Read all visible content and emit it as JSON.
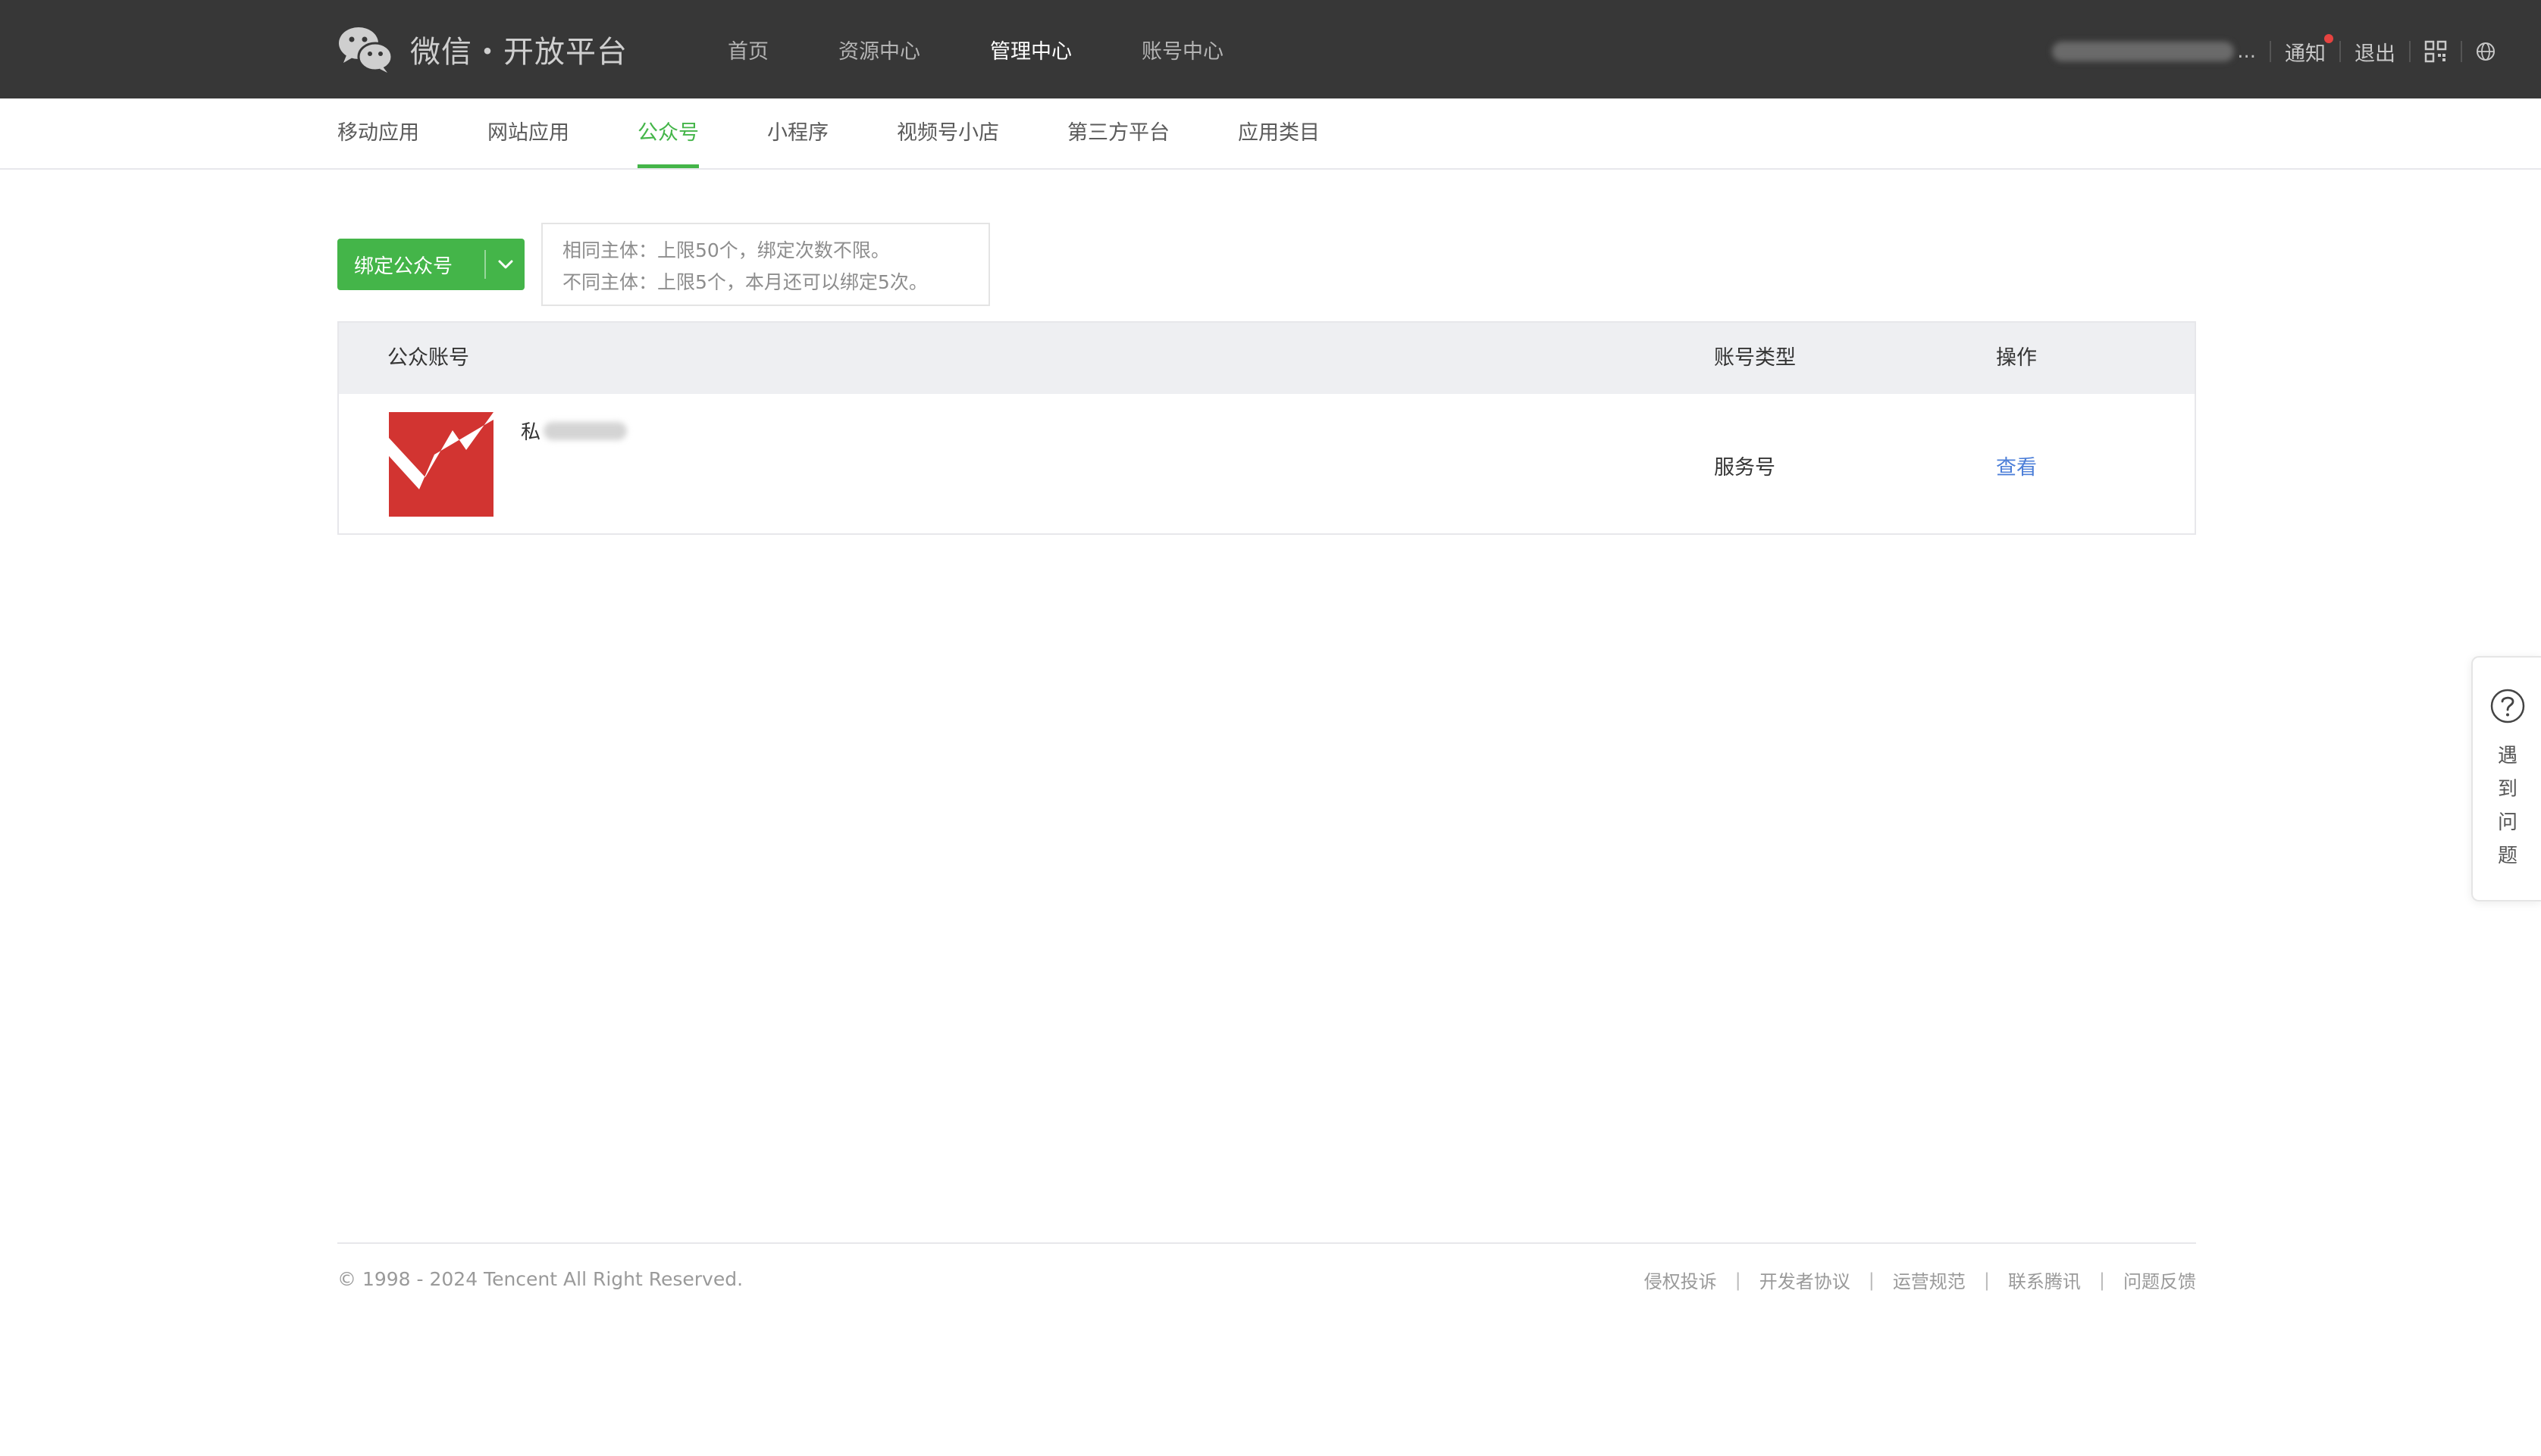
{
  "brand": {
    "name": "微信・开放平台"
  },
  "main_nav": [
    {
      "label": "首页",
      "active": false
    },
    {
      "label": "资源中心",
      "active": false
    },
    {
      "label": "管理中心",
      "active": true
    },
    {
      "label": "账号中心",
      "active": false
    }
  ],
  "user_nav": {
    "username_suffix": "...",
    "notify_label": "通知",
    "logout_label": "退出"
  },
  "sub_nav": [
    {
      "label": "移动应用",
      "active": false
    },
    {
      "label": "网站应用",
      "active": false
    },
    {
      "label": "公众号",
      "active": true
    },
    {
      "label": "小程序",
      "active": false
    },
    {
      "label": "视频号小店",
      "active": false
    },
    {
      "label": "第三方平台",
      "active": false
    },
    {
      "label": "应用类目",
      "active": false
    }
  ],
  "bind": {
    "button_label": "绑定公众号",
    "hint_line1": "相同主体：上限50个，绑定次数不限。",
    "hint_line2": "不同主体：上限5个，本月还可以绑定5次。"
  },
  "table": {
    "headers": {
      "account": "公众账号",
      "type": "账号类型",
      "action": "操作"
    },
    "rows": [
      {
        "name": "私",
        "type": "服务号",
        "action": "查看"
      }
    ]
  },
  "footer": {
    "copyright": "© 1998 - 2024 Tencent All Right Reserved.",
    "links": [
      "侵权投诉",
      "开发者协议",
      "运营规范",
      "联系腾讯",
      "问题反馈"
    ],
    "separator": "|"
  },
  "help": {
    "chars": [
      "遇",
      "到",
      "问",
      "题"
    ]
  },
  "colors": {
    "topbar": "#373737",
    "accent_green": "#44b549",
    "link_blue": "#4d7fd8",
    "notify_dot": "#e64340",
    "avatar_red": "#d23431"
  }
}
